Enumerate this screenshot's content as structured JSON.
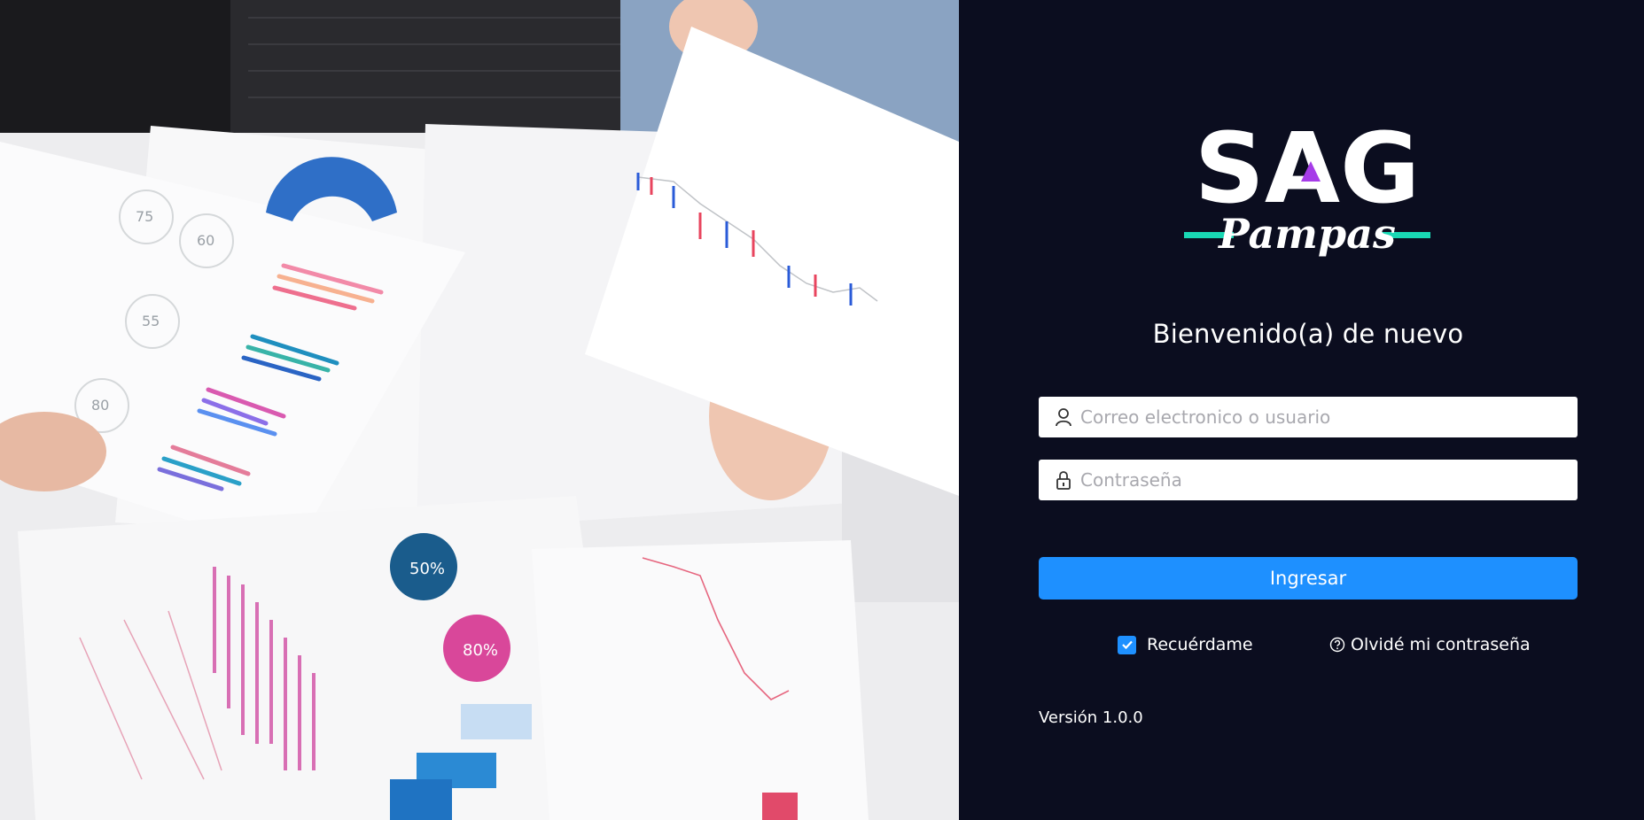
{
  "hero": {
    "image_description": "",
    "icon": "hero-photo",
    "gauge_labels": [
      "75",
      "60",
      "55",
      "80",
      "50%",
      "80%"
    ]
  },
  "logo": {
    "brand_text": "SAG",
    "sub_text": "Pampas",
    "colors": {
      "white": "#ffffff",
      "accent_purple": "#a63ce8",
      "accent_teal": "#19d8b4"
    }
  },
  "login": {
    "welcome": "Bienvenido(a) de nuevo",
    "username_placeholder": "Correo electronico o usuario",
    "username_icon": "user-icon",
    "password_placeholder": "Contraseña",
    "password_icon": "lock-icon",
    "submit_label": "Ingresar",
    "remember_label": "Recuérdame",
    "remember_checked": true,
    "forgot_label": "Olvidé mi contraseña",
    "forgot_icon": "question-circle-icon"
  },
  "footer": {
    "version": "Versión 1.0.0"
  },
  "theme": {
    "panel_bg": "#0b0d1f",
    "primary": "#1e90ff"
  }
}
